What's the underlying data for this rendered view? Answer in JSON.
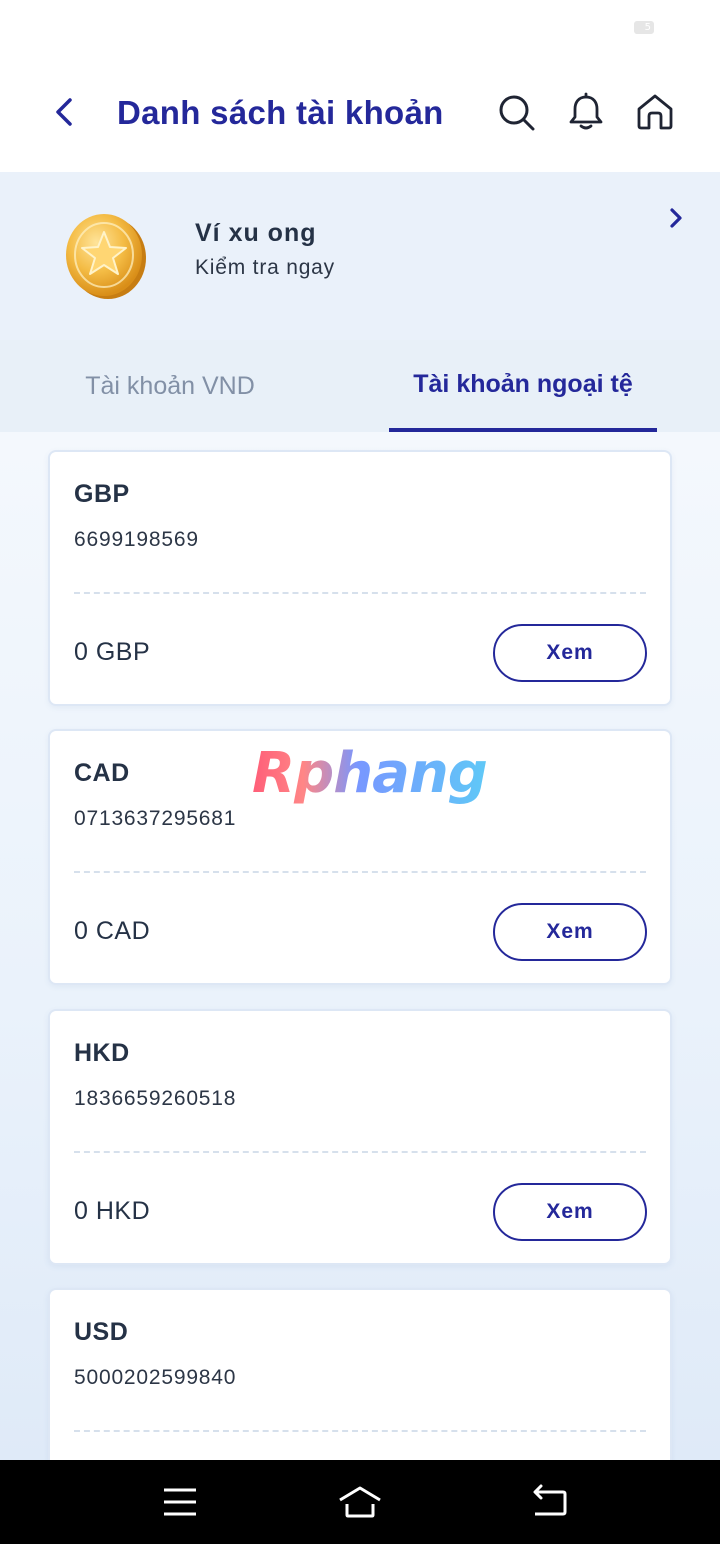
{
  "status_bar": {
    "battery": "5"
  },
  "header": {
    "title": "Danh sách tài khoản"
  },
  "promo": {
    "title": "Ví xu ong",
    "subtitle": "Kiểm tra ngay"
  },
  "tabs": [
    {
      "label": "Tài khoản VND",
      "active": false
    },
    {
      "label": "Tài khoản ngoại tệ",
      "active": true
    }
  ],
  "accounts": [
    {
      "currency": "GBP",
      "number": "6699198569",
      "balance": "0 GBP",
      "button": "Xem"
    },
    {
      "currency": "CAD",
      "number": "0713637295681",
      "balance": "0 CAD",
      "button": "Xem"
    },
    {
      "currency": "HKD",
      "number": "1836659260518",
      "balance": "0 HKD",
      "button": "Xem"
    },
    {
      "currency": "USD",
      "number": "5000202599840",
      "balance": "",
      "button": ""
    }
  ],
  "watermark": "Rphang",
  "colors": {
    "primary": "#24289a",
    "banner_bg": "#eaf1fa",
    "tab_bg": "#e8f0f8",
    "coin": "#f0b43c"
  },
  "icons": [
    "back-icon",
    "search-icon",
    "bell-icon",
    "home-icon",
    "coin-icon",
    "chevron-right-icon",
    "menu-icon",
    "nav-home-icon",
    "nav-back-icon"
  ]
}
